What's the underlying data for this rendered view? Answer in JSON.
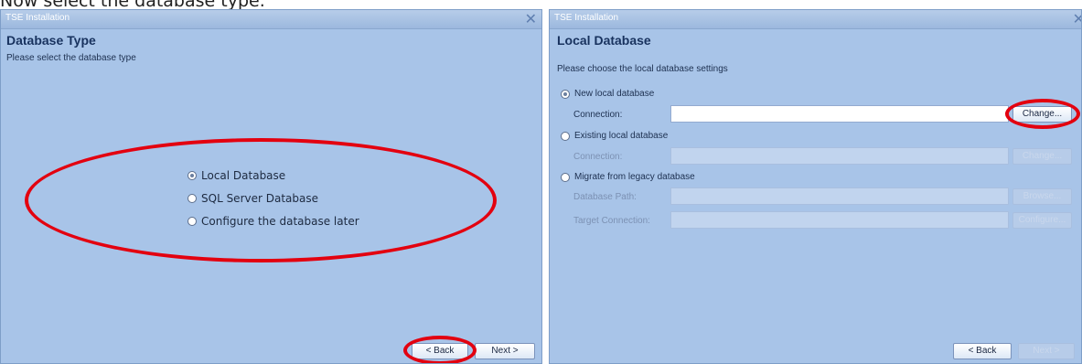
{
  "caption": "Now select the database type.",
  "left_window": {
    "title": "TSE Installation",
    "close_glyph": "✕",
    "heading": "Database Type",
    "subtitle": "Please select the database type",
    "options": [
      {
        "label": "Local Database",
        "selected": true
      },
      {
        "label": "SQL Server Database",
        "selected": false
      },
      {
        "label": "Configure the database later",
        "selected": false
      }
    ],
    "buttons": {
      "back": "< Back",
      "next": "Next >"
    }
  },
  "right_window": {
    "title": "TSE Installation",
    "close_glyph": "✕",
    "heading": "Local Database",
    "subtitle": "Please choose the local database settings",
    "new_db": {
      "label": "New local database",
      "selected": true,
      "connection_label": "Connection:",
      "connection_value": "",
      "button": "Change..."
    },
    "existing_db": {
      "label": "Existing local database",
      "selected": false,
      "connection_label": "Connection:",
      "connection_value": "",
      "button": "Change..."
    },
    "migrate_db": {
      "label": "Migrate from legacy database",
      "selected": false,
      "path_label": "Database Path:",
      "path_value": "",
      "path_button": "Browse...",
      "target_label": "Target Connection:",
      "target_value": "",
      "target_button": "Configure..."
    },
    "buttons": {
      "back": "< Back",
      "next": "Next >"
    }
  },
  "colors": {
    "panel": "#a8c4e8",
    "highlight": "#e3000f",
    "heading": "#18325e"
  },
  "icons": [
    "close-icon",
    "radio-selected-icon",
    "radio-empty-icon"
  ]
}
